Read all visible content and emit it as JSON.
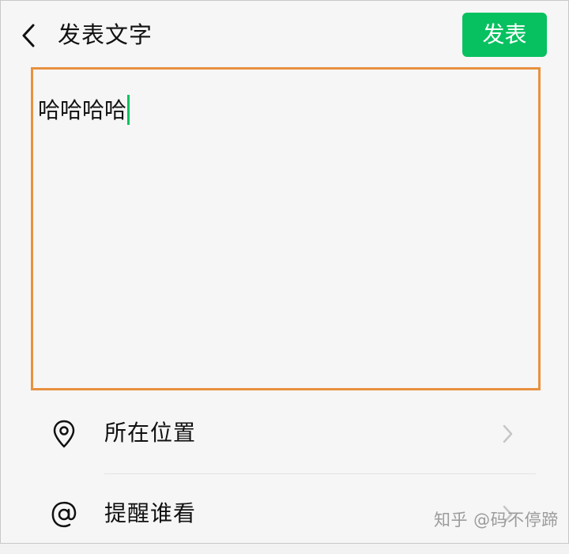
{
  "header": {
    "title": "发表文字",
    "publish_label": "发表"
  },
  "editor": {
    "text": "哈哈哈哈"
  },
  "options": {
    "location_label": "所在位置",
    "remind_label": "提醒谁看"
  },
  "icons": {
    "back": "chevron-left-icon",
    "location": "location-pin-icon",
    "mention": "at-sign-icon",
    "chevron": "chevron-right-icon"
  },
  "watermark": "知乎 @码不停蹄",
  "colors": {
    "accent": "#07c160",
    "highlight_border": "#e8913f"
  }
}
